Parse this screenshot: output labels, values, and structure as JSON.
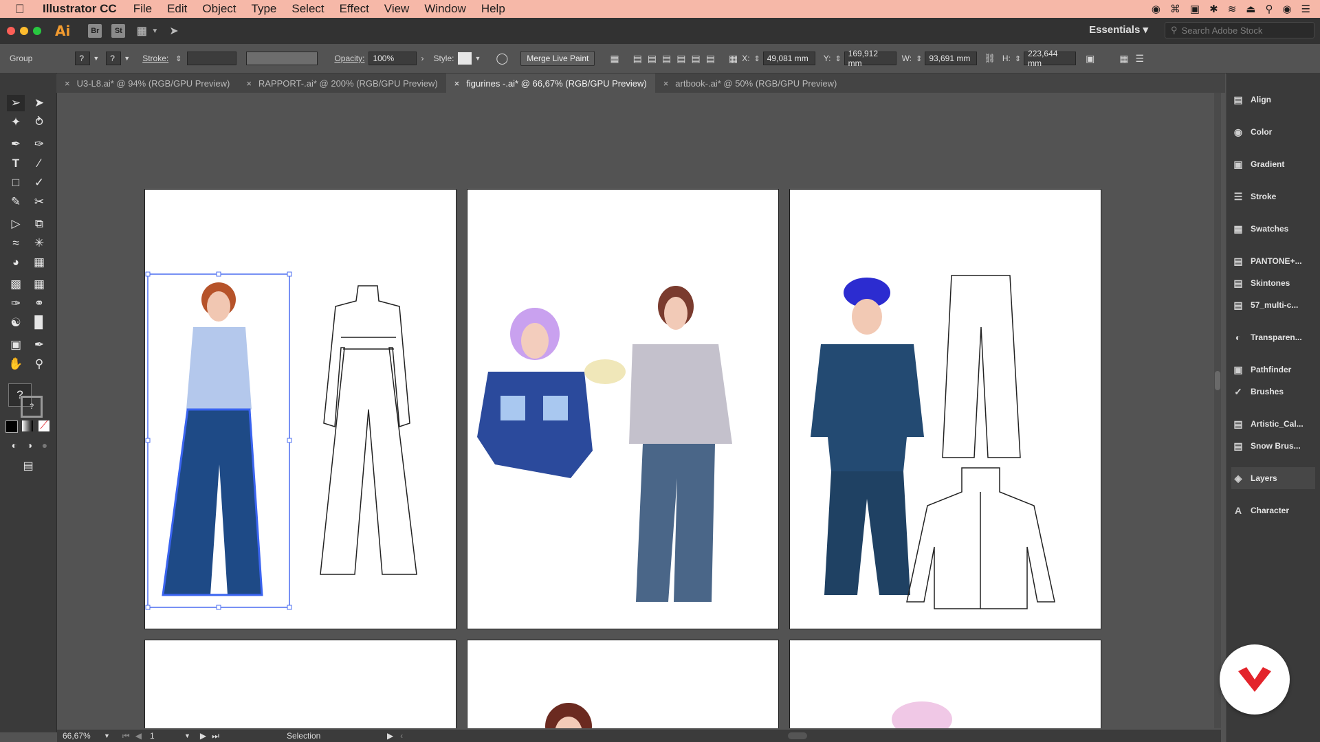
{
  "menubar": {
    "app_name": "Illustrator CC",
    "items": [
      "File",
      "Edit",
      "Object",
      "Type",
      "Select",
      "Effect",
      "View",
      "Window",
      "Help"
    ]
  },
  "appbar": {
    "logo": "Ai",
    "bridge": "Br",
    "stock": "St",
    "workspace": "Essentials",
    "search_placeholder": "Search Adobe Stock"
  },
  "control": {
    "selection_type": "Group",
    "stroke_label": "Stroke:",
    "opacity_label": "Opacity:",
    "opacity_value": "100%",
    "style_label": "Style:",
    "merge_button": "Merge Live Paint",
    "x_label": "X:",
    "x_value": "49,081 mm",
    "y_label": "Y:",
    "y_value": "169,912 mm",
    "w_label": "W:",
    "w_value": "93,691 mm",
    "h_label": "H:",
    "h_value": "223,644 mm"
  },
  "tabs": [
    {
      "label": "U3-L8.ai* @ 94% (RGB/GPU Preview)"
    },
    {
      "label": "RAPPORT-.ai* @ 200% (RGB/GPU Preview)"
    },
    {
      "label": "figurines -.ai* @ 66,67% (RGB/GPU Preview)"
    },
    {
      "label": "artbook-.ai* @ 50% (RGB/GPU Preview)"
    }
  ],
  "panels": [
    {
      "label": "Align",
      "icon": "align-icon"
    },
    {
      "label": "Color",
      "icon": "color-icon"
    },
    {
      "label": "Gradient",
      "icon": "gradient-icon"
    },
    {
      "label": "Stroke",
      "icon": "stroke-icon"
    },
    {
      "label": "Swatches",
      "icon": "swatches-icon"
    },
    {
      "label": "PANTONE+...",
      "icon": "library-icon"
    },
    {
      "label": "Skintones",
      "icon": "library-icon"
    },
    {
      "label": "57_multi-c...",
      "icon": "library-icon"
    },
    {
      "label": "Transparen...",
      "icon": "transparency-icon"
    },
    {
      "label": "Pathfinder",
      "icon": "pathfinder-icon"
    },
    {
      "label": "Brushes",
      "icon": "brushes-icon"
    },
    {
      "label": "Artistic_Cal...",
      "icon": "brush-library-icon"
    },
    {
      "label": "Snow Brus...",
      "icon": "brush-library-icon"
    },
    {
      "label": "Layers",
      "icon": "layers-icon"
    },
    {
      "label": "Character",
      "icon": "character-icon"
    }
  ],
  "status": {
    "zoom": "66,67%",
    "artboard": "1",
    "tool": "Selection"
  },
  "colors": {
    "menubar": "#f6b8a8",
    "ai_orange": "#f29b2f",
    "selection_blue": "#4a6cf0",
    "badge_red": "#e3242b"
  }
}
